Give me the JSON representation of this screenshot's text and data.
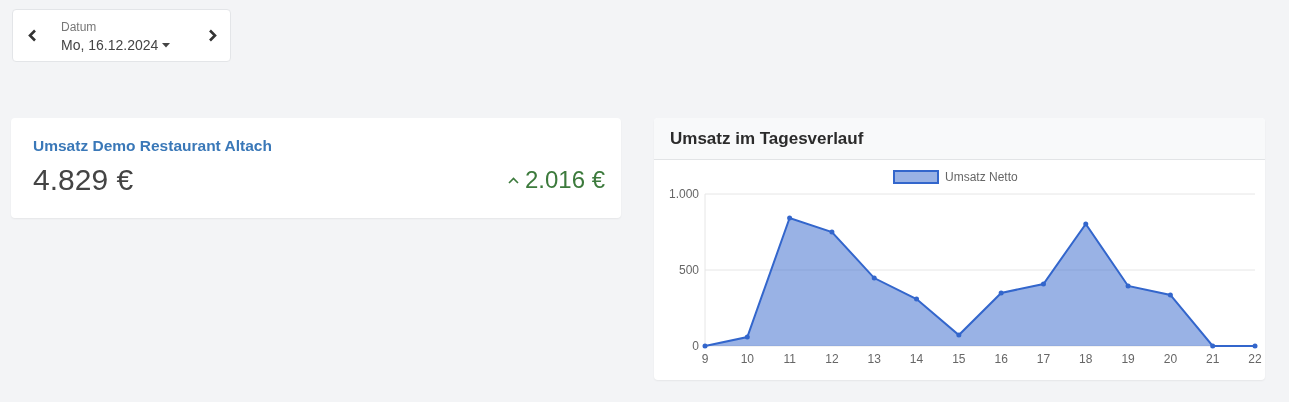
{
  "date_picker": {
    "label": "Datum",
    "value": "Mo, 16.12.2024"
  },
  "revenue_card": {
    "title": "Umsatz Demo Restaurant Altach",
    "value": "4.829 €",
    "change": "2.016 €",
    "trend_up": true
  },
  "chart_card": {
    "title": "Umsatz im Tagesverlauf",
    "chart_data": {
      "type": "area",
      "x": [
        "9",
        "10",
        "11",
        "12",
        "13",
        "14",
        "15",
        "16",
        "17",
        "18",
        "19",
        "20",
        "21",
        "22"
      ],
      "series": [
        {
          "name": "Umsatz Netto",
          "color": "#3366cc",
          "values": [
            0,
            59,
            842,
            750,
            447,
            309,
            72,
            349,
            408,
            803,
            395,
            336,
            0,
            0
          ]
        }
      ],
      "ylim": [
        0,
        1000
      ],
      "yticks": [
        {
          "value": 0,
          "label": "0"
        },
        {
          "value": 500,
          "label": "500"
        },
        {
          "value": 1000,
          "label": "1.000"
        }
      ]
    }
  }
}
